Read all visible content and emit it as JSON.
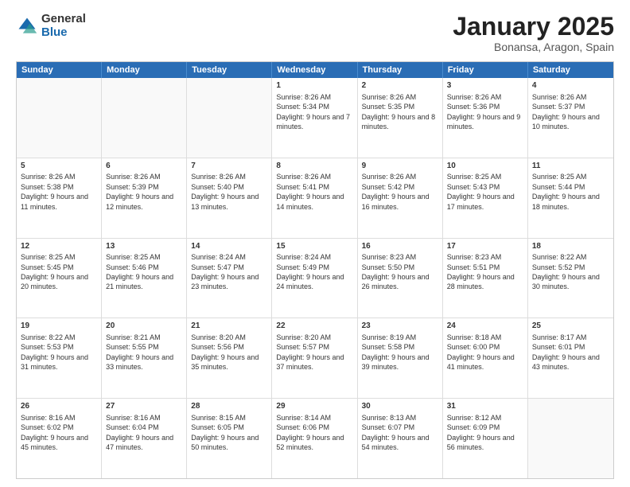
{
  "logo": {
    "general": "General",
    "blue": "Blue"
  },
  "header": {
    "month": "January 2025",
    "location": "Bonansa, Aragon, Spain"
  },
  "weekdays": [
    "Sunday",
    "Monday",
    "Tuesday",
    "Wednesday",
    "Thursday",
    "Friday",
    "Saturday"
  ],
  "rows": [
    [
      {
        "day": "",
        "content": ""
      },
      {
        "day": "",
        "content": ""
      },
      {
        "day": "",
        "content": ""
      },
      {
        "day": "1",
        "content": "Sunrise: 8:26 AM\nSunset: 5:34 PM\nDaylight: 9 hours\nand 7 minutes."
      },
      {
        "day": "2",
        "content": "Sunrise: 8:26 AM\nSunset: 5:35 PM\nDaylight: 9 hours\nand 8 minutes."
      },
      {
        "day": "3",
        "content": "Sunrise: 8:26 AM\nSunset: 5:36 PM\nDaylight: 9 hours\nand 9 minutes."
      },
      {
        "day": "4",
        "content": "Sunrise: 8:26 AM\nSunset: 5:37 PM\nDaylight: 9 hours\nand 10 minutes."
      }
    ],
    [
      {
        "day": "5",
        "content": "Sunrise: 8:26 AM\nSunset: 5:38 PM\nDaylight: 9 hours\nand 11 minutes."
      },
      {
        "day": "6",
        "content": "Sunrise: 8:26 AM\nSunset: 5:39 PM\nDaylight: 9 hours\nand 12 minutes."
      },
      {
        "day": "7",
        "content": "Sunrise: 8:26 AM\nSunset: 5:40 PM\nDaylight: 9 hours\nand 13 minutes."
      },
      {
        "day": "8",
        "content": "Sunrise: 8:26 AM\nSunset: 5:41 PM\nDaylight: 9 hours\nand 14 minutes."
      },
      {
        "day": "9",
        "content": "Sunrise: 8:26 AM\nSunset: 5:42 PM\nDaylight: 9 hours\nand 16 minutes."
      },
      {
        "day": "10",
        "content": "Sunrise: 8:25 AM\nSunset: 5:43 PM\nDaylight: 9 hours\nand 17 minutes."
      },
      {
        "day": "11",
        "content": "Sunrise: 8:25 AM\nSunset: 5:44 PM\nDaylight: 9 hours\nand 18 minutes."
      }
    ],
    [
      {
        "day": "12",
        "content": "Sunrise: 8:25 AM\nSunset: 5:45 PM\nDaylight: 9 hours\nand 20 minutes."
      },
      {
        "day": "13",
        "content": "Sunrise: 8:25 AM\nSunset: 5:46 PM\nDaylight: 9 hours\nand 21 minutes."
      },
      {
        "day": "14",
        "content": "Sunrise: 8:24 AM\nSunset: 5:47 PM\nDaylight: 9 hours\nand 23 minutes."
      },
      {
        "day": "15",
        "content": "Sunrise: 8:24 AM\nSunset: 5:49 PM\nDaylight: 9 hours\nand 24 minutes."
      },
      {
        "day": "16",
        "content": "Sunrise: 8:23 AM\nSunset: 5:50 PM\nDaylight: 9 hours\nand 26 minutes."
      },
      {
        "day": "17",
        "content": "Sunrise: 8:23 AM\nSunset: 5:51 PM\nDaylight: 9 hours\nand 28 minutes."
      },
      {
        "day": "18",
        "content": "Sunrise: 8:22 AM\nSunset: 5:52 PM\nDaylight: 9 hours\nand 30 minutes."
      }
    ],
    [
      {
        "day": "19",
        "content": "Sunrise: 8:22 AM\nSunset: 5:53 PM\nDaylight: 9 hours\nand 31 minutes."
      },
      {
        "day": "20",
        "content": "Sunrise: 8:21 AM\nSunset: 5:55 PM\nDaylight: 9 hours\nand 33 minutes."
      },
      {
        "day": "21",
        "content": "Sunrise: 8:20 AM\nSunset: 5:56 PM\nDaylight: 9 hours\nand 35 minutes."
      },
      {
        "day": "22",
        "content": "Sunrise: 8:20 AM\nSunset: 5:57 PM\nDaylight: 9 hours\nand 37 minutes."
      },
      {
        "day": "23",
        "content": "Sunrise: 8:19 AM\nSunset: 5:58 PM\nDaylight: 9 hours\nand 39 minutes."
      },
      {
        "day": "24",
        "content": "Sunrise: 8:18 AM\nSunset: 6:00 PM\nDaylight: 9 hours\nand 41 minutes."
      },
      {
        "day": "25",
        "content": "Sunrise: 8:17 AM\nSunset: 6:01 PM\nDaylight: 9 hours\nand 43 minutes."
      }
    ],
    [
      {
        "day": "26",
        "content": "Sunrise: 8:16 AM\nSunset: 6:02 PM\nDaylight: 9 hours\nand 45 minutes."
      },
      {
        "day": "27",
        "content": "Sunrise: 8:16 AM\nSunset: 6:04 PM\nDaylight: 9 hours\nand 47 minutes."
      },
      {
        "day": "28",
        "content": "Sunrise: 8:15 AM\nSunset: 6:05 PM\nDaylight: 9 hours\nand 50 minutes."
      },
      {
        "day": "29",
        "content": "Sunrise: 8:14 AM\nSunset: 6:06 PM\nDaylight: 9 hours\nand 52 minutes."
      },
      {
        "day": "30",
        "content": "Sunrise: 8:13 AM\nSunset: 6:07 PM\nDaylight: 9 hours\nand 54 minutes."
      },
      {
        "day": "31",
        "content": "Sunrise: 8:12 AM\nSunset: 6:09 PM\nDaylight: 9 hours\nand 56 minutes."
      },
      {
        "day": "",
        "content": ""
      }
    ]
  ]
}
